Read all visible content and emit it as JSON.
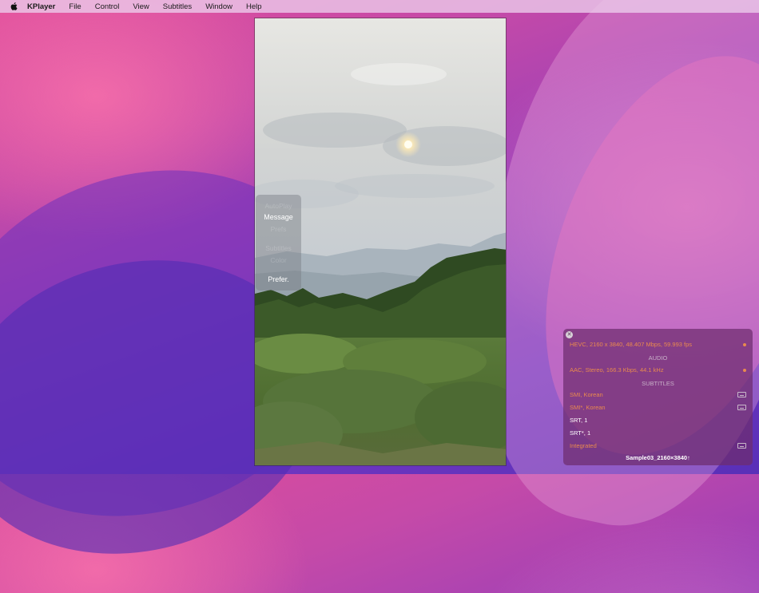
{
  "menubar": {
    "app_name": "KPlayer",
    "items": [
      "File",
      "Control",
      "View",
      "Subtitles",
      "Window",
      "Help"
    ]
  },
  "overlay_menu": {
    "items": [
      "AutoPlay",
      "Message",
      "Prefs",
      "Subtitles",
      "Color",
      "Prefer."
    ],
    "highlighted": [
      "Message",
      "Prefer."
    ]
  },
  "info_panel": {
    "video_track": "HEVC, 2160 x 3840, 48.407 Mbps, 59.993 fps",
    "audio_heading": "AUDIO",
    "audio_track": "AAC, Stereo, 166.3 Kbps, 44.1 kHz",
    "subtitles_heading": "SUBTITLES",
    "subtitles": [
      {
        "label": "SMI, Korean",
        "color": "#e98a4e",
        "icon": "subtitle-file-icon"
      },
      {
        "label": "SMI*, Korean",
        "color": "#e98a4e",
        "icon": "subtitle-file-icon"
      },
      {
        "label": "SRT, 1",
        "color": "#ffffff",
        "icon": ""
      },
      {
        "label": "SRT*, 1",
        "color": "#ffffff",
        "icon": ""
      },
      {
        "label": "Integrated",
        "color": "#e98a4e",
        "icon": "subtitle-file-icon"
      }
    ],
    "footer": "Sample03_2160×3840↑"
  },
  "colors": {
    "accent_orange": "#e98a4e",
    "panel_bg": "#6e2d6e"
  }
}
